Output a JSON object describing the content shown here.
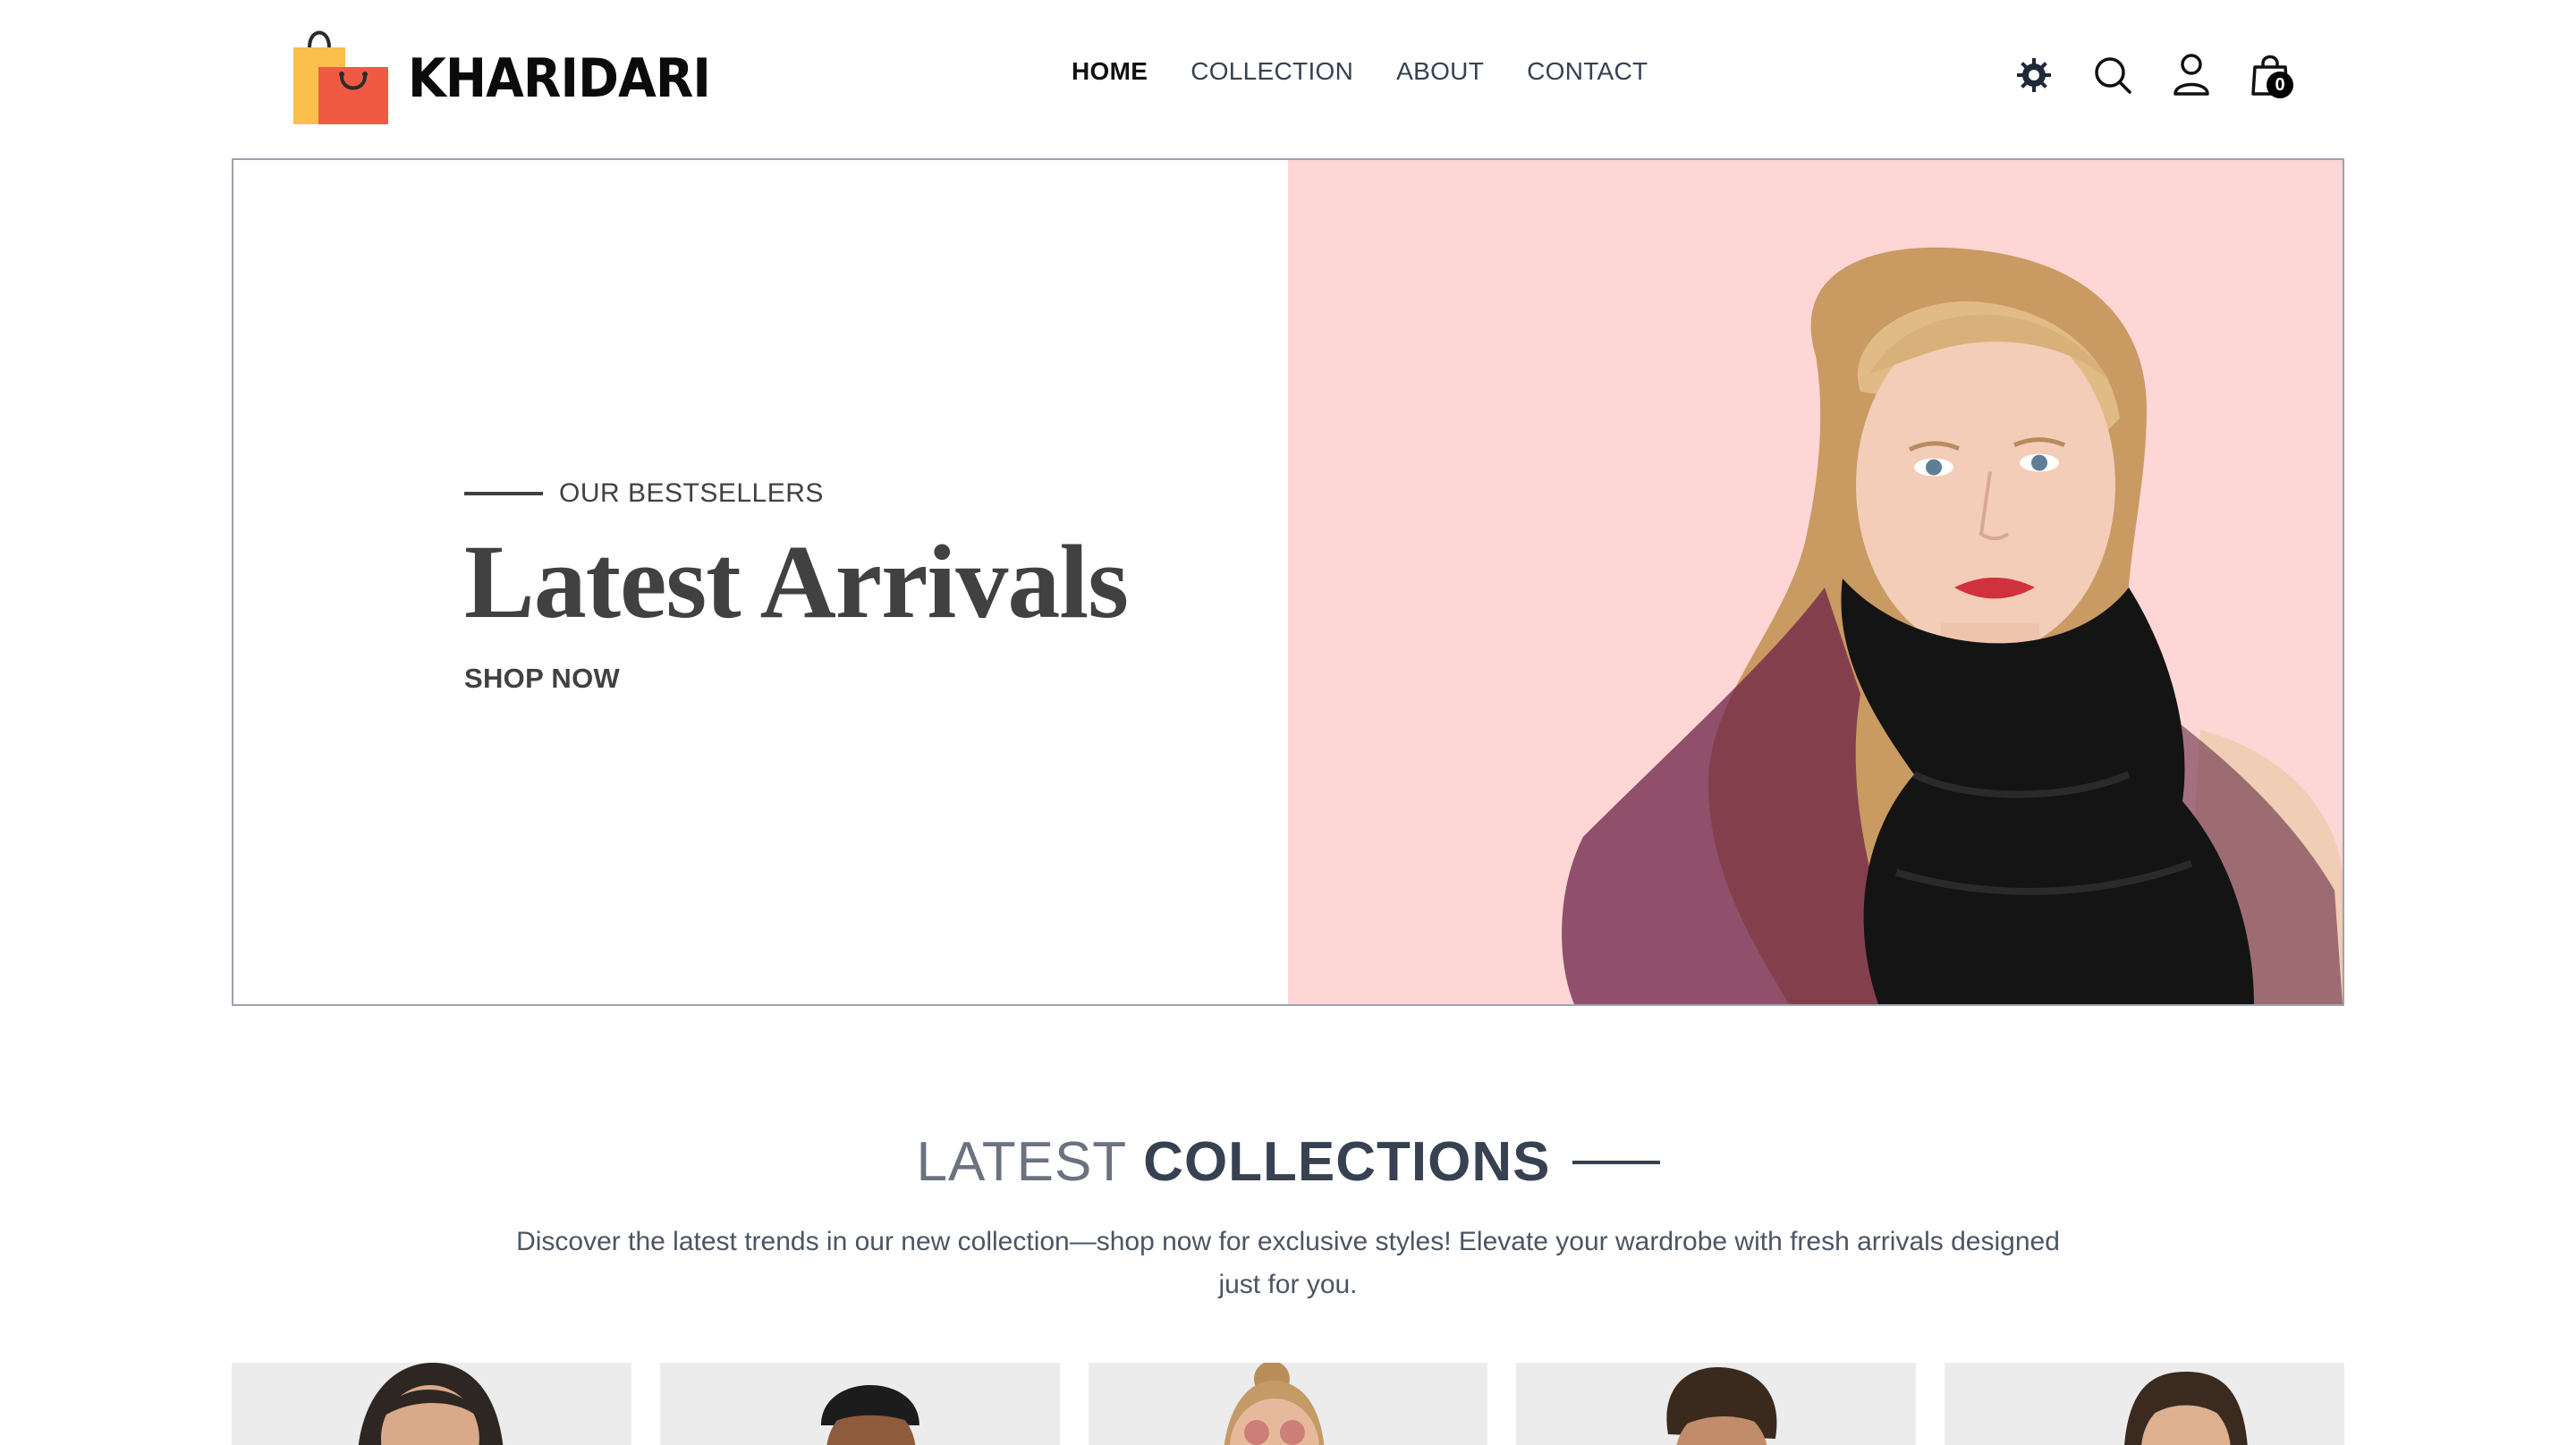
{
  "brand": {
    "name": "KHARIDARI"
  },
  "nav": {
    "items": [
      {
        "label": "HOME",
        "active": true
      },
      {
        "label": "COLLECTION",
        "active": false
      },
      {
        "label": "ABOUT",
        "active": false
      },
      {
        "label": "CONTACT",
        "active": false
      }
    ]
  },
  "header_icons": [
    "theme-settings-icon",
    "search-icon",
    "user-icon",
    "cart-icon"
  ],
  "cart": {
    "count": "0"
  },
  "hero": {
    "eyebrow": "OUR BESTSELLERS",
    "title": "Latest Arrivals",
    "cta": "SHOP NOW",
    "background_color": "#ffd6d6"
  },
  "collections": {
    "title_light": "LATEST",
    "title_bold": "COLLECTIONS",
    "description": "Discover the latest trends in our new collection—shop now for exclusive styles! Elevate your wardrobe with fresh arrivals designed just for you."
  },
  "colors": {
    "text": "#374151",
    "border": "#9ca3af",
    "logo_bag_back": "#fbbf4b",
    "logo_bag_front": "#f05a45"
  }
}
